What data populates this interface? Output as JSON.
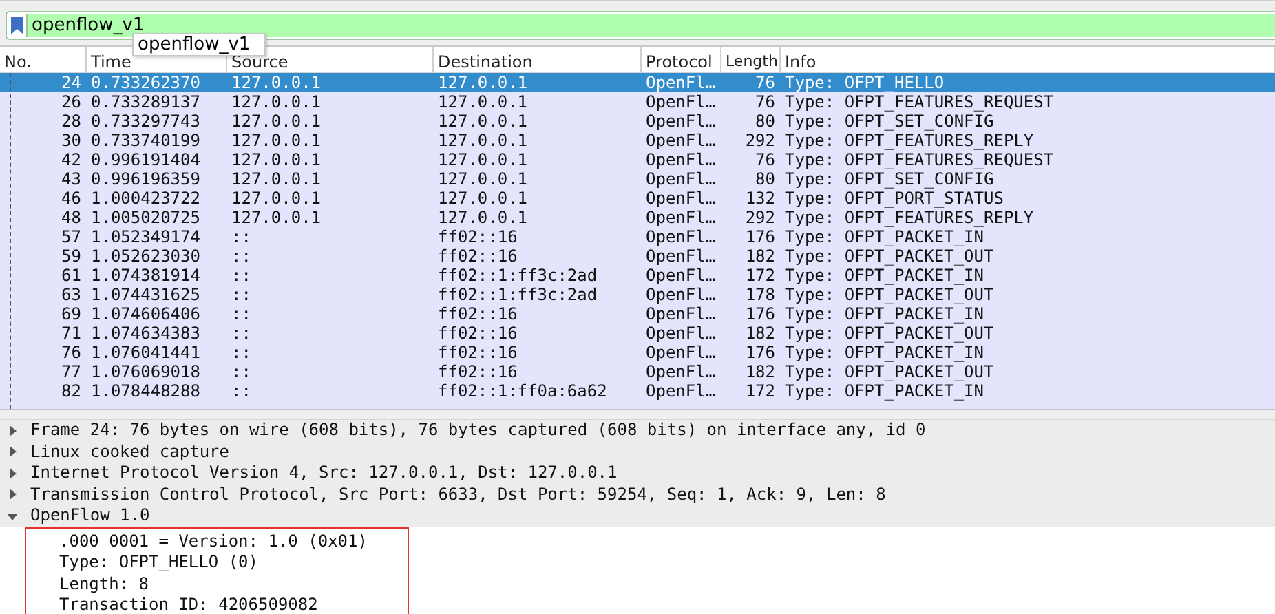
{
  "filter": {
    "value": "openflow_v1",
    "suggestion": "openflow_v1"
  },
  "packet_list": {
    "columns": [
      "No.",
      "Time",
      "Source",
      "Destination",
      "Protocol",
      "Length",
      "Info"
    ],
    "rows": [
      {
        "no": "24",
        "time": "0.733262370",
        "source": "127.0.0.1",
        "destination": "127.0.0.1",
        "protocol": "OpenFl…",
        "length": "76",
        "info": "Type: OFPT_HELLO",
        "selected": true
      },
      {
        "no": "26",
        "time": "0.733289137",
        "source": "127.0.0.1",
        "destination": "127.0.0.1",
        "protocol": "OpenFl…",
        "length": "76",
        "info": "Type: OFPT_FEATURES_REQUEST",
        "selected": false
      },
      {
        "no": "28",
        "time": "0.733297743",
        "source": "127.0.0.1",
        "destination": "127.0.0.1",
        "protocol": "OpenFl…",
        "length": "80",
        "info": "Type: OFPT_SET_CONFIG",
        "selected": false
      },
      {
        "no": "30",
        "time": "0.733740199",
        "source": "127.0.0.1",
        "destination": "127.0.0.1",
        "protocol": "OpenFl…",
        "length": "292",
        "info": "Type: OFPT_FEATURES_REPLY",
        "selected": false
      },
      {
        "no": "42",
        "time": "0.996191404",
        "source": "127.0.0.1",
        "destination": "127.0.0.1",
        "protocol": "OpenFl…",
        "length": "76",
        "info": "Type: OFPT_FEATURES_REQUEST",
        "selected": false
      },
      {
        "no": "43",
        "time": "0.996196359",
        "source": "127.0.0.1",
        "destination": "127.0.0.1",
        "protocol": "OpenFl…",
        "length": "80",
        "info": "Type: OFPT_SET_CONFIG",
        "selected": false
      },
      {
        "no": "46",
        "time": "1.000423722",
        "source": "127.0.0.1",
        "destination": "127.0.0.1",
        "protocol": "OpenFl…",
        "length": "132",
        "info": "Type: OFPT_PORT_STATUS",
        "selected": false
      },
      {
        "no": "48",
        "time": "1.005020725",
        "source": "127.0.0.1",
        "destination": "127.0.0.1",
        "protocol": "OpenFl…",
        "length": "292",
        "info": "Type: OFPT_FEATURES_REPLY",
        "selected": false
      },
      {
        "no": "57",
        "time": "1.052349174",
        "source": "::",
        "destination": "ff02::16",
        "protocol": "OpenFl…",
        "length": "176",
        "info": "Type: OFPT_PACKET_IN",
        "selected": false
      },
      {
        "no": "59",
        "time": "1.052623030",
        "source": "::",
        "destination": "ff02::16",
        "protocol": "OpenFl…",
        "length": "182",
        "info": "Type: OFPT_PACKET_OUT",
        "selected": false
      },
      {
        "no": "61",
        "time": "1.074381914",
        "source": "::",
        "destination": "ff02::1:ff3c:2ad",
        "protocol": "OpenFl…",
        "length": "172",
        "info": "Type: OFPT_PACKET_IN",
        "selected": false
      },
      {
        "no": "63",
        "time": "1.074431625",
        "source": "::",
        "destination": "ff02::1:ff3c:2ad",
        "protocol": "OpenFl…",
        "length": "178",
        "info": "Type: OFPT_PACKET_OUT",
        "selected": false
      },
      {
        "no": "69",
        "time": "1.074606406",
        "source": "::",
        "destination": "ff02::16",
        "protocol": "OpenFl…",
        "length": "176",
        "info": "Type: OFPT_PACKET_IN",
        "selected": false
      },
      {
        "no": "71",
        "time": "1.074634383",
        "source": "::",
        "destination": "ff02::16",
        "protocol": "OpenFl…",
        "length": "182",
        "info": "Type: OFPT_PACKET_OUT",
        "selected": false
      },
      {
        "no": "76",
        "time": "1.076041441",
        "source": "::",
        "destination": "ff02::16",
        "protocol": "OpenFl…",
        "length": "176",
        "info": "Type: OFPT_PACKET_IN",
        "selected": false
      },
      {
        "no": "77",
        "time": "1.076069018",
        "source": "::",
        "destination": "ff02::16",
        "protocol": "OpenFl…",
        "length": "182",
        "info": "Type: OFPT_PACKET_OUT",
        "selected": false
      },
      {
        "no": "82",
        "time": "1.078448288",
        "source": "::",
        "destination": "ff02::1:ff0a:6a62",
        "protocol": "OpenFl…",
        "length": "172",
        "info": "Type: OFPT_PACKET_IN",
        "selected": false
      }
    ]
  },
  "details": [
    {
      "label": "Frame 24: 76 bytes on wire (608 bits), 76 bytes captured (608 bits) on interface any, id 0",
      "expanded": false
    },
    {
      "label": "Linux cooked capture",
      "expanded": false
    },
    {
      "label": "Internet Protocol Version 4, Src: 127.0.0.1, Dst: 127.0.0.1",
      "expanded": false
    },
    {
      "label": "Transmission Control Protocol, Src Port: 6633, Dst Port: 59254, Seq: 1, Ack: 9, Len: 8",
      "expanded": false
    },
    {
      "label": "OpenFlow 1.0",
      "expanded": true,
      "children": [
        {
          "label": ".000 0001 = Version: 1.0 (0x01)"
        },
        {
          "label": "Type: OFPT_HELLO (0)"
        },
        {
          "label": "Length: 8"
        },
        {
          "label": "Transaction ID: 4206509082"
        }
      ]
    }
  ]
}
